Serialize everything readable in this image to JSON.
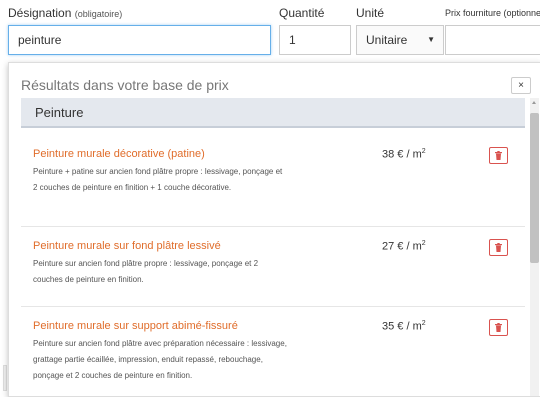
{
  "form": {
    "designation_label": "Désignation",
    "designation_hint": "(obligatoire)",
    "designation_value": "peinture",
    "quantite_label": "Quantité",
    "quantite_value": "1",
    "unite_label": "Unité",
    "unite_value": "Unitaire",
    "prix_label": "Prix fourniture (optionne"
  },
  "dropdown": {
    "title": "Résultats dans votre base de prix",
    "close_label": "×",
    "category": "Peinture",
    "results": [
      {
        "title": "Peinture murale décorative (patine)",
        "description": "Peinture + patine sur ancien fond plâtre propre : lessivage, ponçage et 2 couches de peinture en finition + 1 couche décorative.",
        "price": "38 € / m",
        "price_exp": "2"
      },
      {
        "title": "Peinture murale sur fond plâtre lessivé",
        "description": "Peinture sur ancien fond plâtre propre : lessivage, ponçage et 2 couches de peinture en finition.",
        "price": "27 € / m",
        "price_exp": "2"
      },
      {
        "title": "Peinture murale sur support abimé-fissuré",
        "description": "Peinture sur ancien fond plâtre avec préparation nécessaire : lessivage, grattage partie écaillée, impression, enduit repassé, rebouchage, ponçage et 2 couches de peinture en finition.",
        "price": "35 € / m",
        "price_exp": "2"
      }
    ]
  },
  "colors": {
    "accent_orange": "#e06d2b",
    "danger_red": "#d9534f",
    "focus_blue": "#66afe9",
    "category_bg": "#e4e8ee"
  },
  "icons": {
    "close": "close-icon",
    "trash": "trash-icon",
    "caret": "caret-down-icon"
  }
}
